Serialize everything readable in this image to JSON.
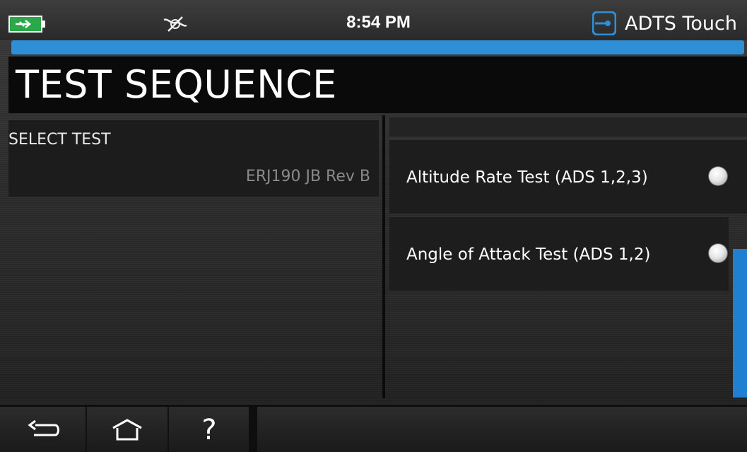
{
  "status": {
    "time": "8:54 PM",
    "brand": "ADTS Touch",
    "icons": [
      "battery-charging-icon",
      "connection-disconnected-icon",
      "brand-logo-icon"
    ]
  },
  "progress": {
    "percent": 100,
    "color": "#2e8fd6"
  },
  "page": {
    "title": "TEST SEQUENCE"
  },
  "select_test": {
    "label": "SELECT TEST",
    "value": "ERJ190 JB Rev B"
  },
  "tests": [
    {
      "label": "Altitude Rate Test (ADS 1,2,3)",
      "selected": false
    },
    {
      "label": "Angle of Attack Test (ADS 1,2)",
      "selected": false
    }
  ],
  "nav": {
    "back": "back-icon",
    "home": "home-icon",
    "help_glyph": "?"
  },
  "colors": {
    "accent": "#2e8fd6",
    "scrollbar": "#1f7fd0",
    "brand": "#2f8fd6"
  }
}
